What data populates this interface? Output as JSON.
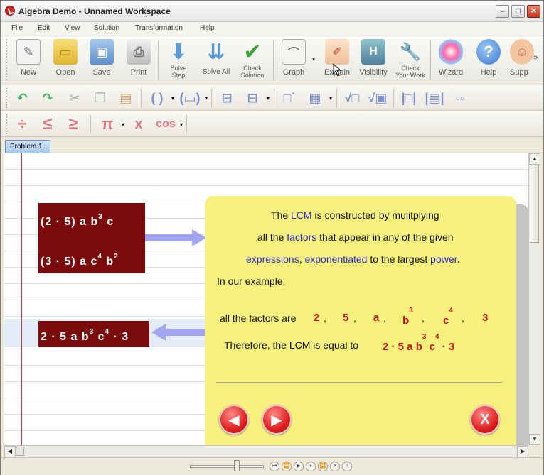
{
  "window": {
    "title": "Algebra Demo - Unnamed Workspace"
  },
  "menu": [
    "File",
    "Edit",
    "View",
    "Solution",
    "Transformation",
    "Help"
  ],
  "toolbar1": [
    {
      "label": "New",
      "icon": "new-doc-icon"
    },
    {
      "label": "Open",
      "icon": "folder-icon"
    },
    {
      "label": "Save",
      "icon": "floppy-icon"
    },
    {
      "label": "Print",
      "icon": "printer-icon"
    },
    {
      "label": "Solve\nStep",
      "icon": "down-arrow-icon"
    },
    {
      "label": "Solve All",
      "icon": "double-down-arrow-icon"
    },
    {
      "label": "Check\nSolution",
      "icon": "check-icon"
    },
    {
      "label": "Graph",
      "icon": "graph-icon"
    },
    {
      "label": "Explain",
      "icon": "explain-icon"
    },
    {
      "label": "Visibility",
      "icon": "visibility-icon"
    },
    {
      "label": "Check\nYour Work",
      "icon": "wrench-icon"
    },
    {
      "label": "Wizard",
      "icon": "wand-icon"
    },
    {
      "label": "Help",
      "icon": "help-icon"
    },
    {
      "label": "Supp",
      "icon": "support-icon"
    }
  ],
  "toolbar3": {
    "pi": "π",
    "cos": "cos",
    "x": "x"
  },
  "tabs": [
    {
      "label": "Problem 1"
    }
  ],
  "expr1": {
    "line1": "(2 · 5) a b",
    "line1_exp": "3",
    "line1_tail": " c",
    "line2": "(3 · 5) a c",
    "line2_exp": "4",
    "line2_mid": " b",
    "line2_exp2": "2"
  },
  "result": {
    "pre": "2 · 5 a b",
    "e1": "3",
    "mid": " c",
    "e2": "4",
    "tail": " · 3"
  },
  "panel": {
    "line1_a": "The ",
    "line1_lcm": "LCM",
    "line1_b": " is constructed by mulitplying",
    "line2_a": "all the ",
    "line2_factors": "factors",
    "line2_b": " that appear in any of the given",
    "line3_expr": "expressions",
    "line3_comma": ", ",
    "line3_expo": "exponentiated",
    "line3_b": " to the largest ",
    "line3_power": "power",
    "line3_dot": ".",
    "line4": "In our example,",
    "line5": "all the factors are",
    "factors": [
      "2",
      "5",
      "a",
      "b",
      "c",
      "3"
    ],
    "factor_b_exp": "3",
    "factor_c_exp": "4",
    "line6": "Therefore, the LCM is equal to",
    "lcm_pre": "2 · 5 a b",
    "lcm_e1": "3",
    "lcm_mid": " c",
    "lcm_e2": "4",
    "lcm_tail": " · 3"
  },
  "nav": {
    "prev": "◀",
    "next": "▶",
    "close": "X"
  },
  "colors": {
    "dark_red_box": "#7b0a0a",
    "panel_yellow": "#f6f07c",
    "highlight_blue": "#2b2bcc",
    "factor_red": "#c0141a"
  }
}
